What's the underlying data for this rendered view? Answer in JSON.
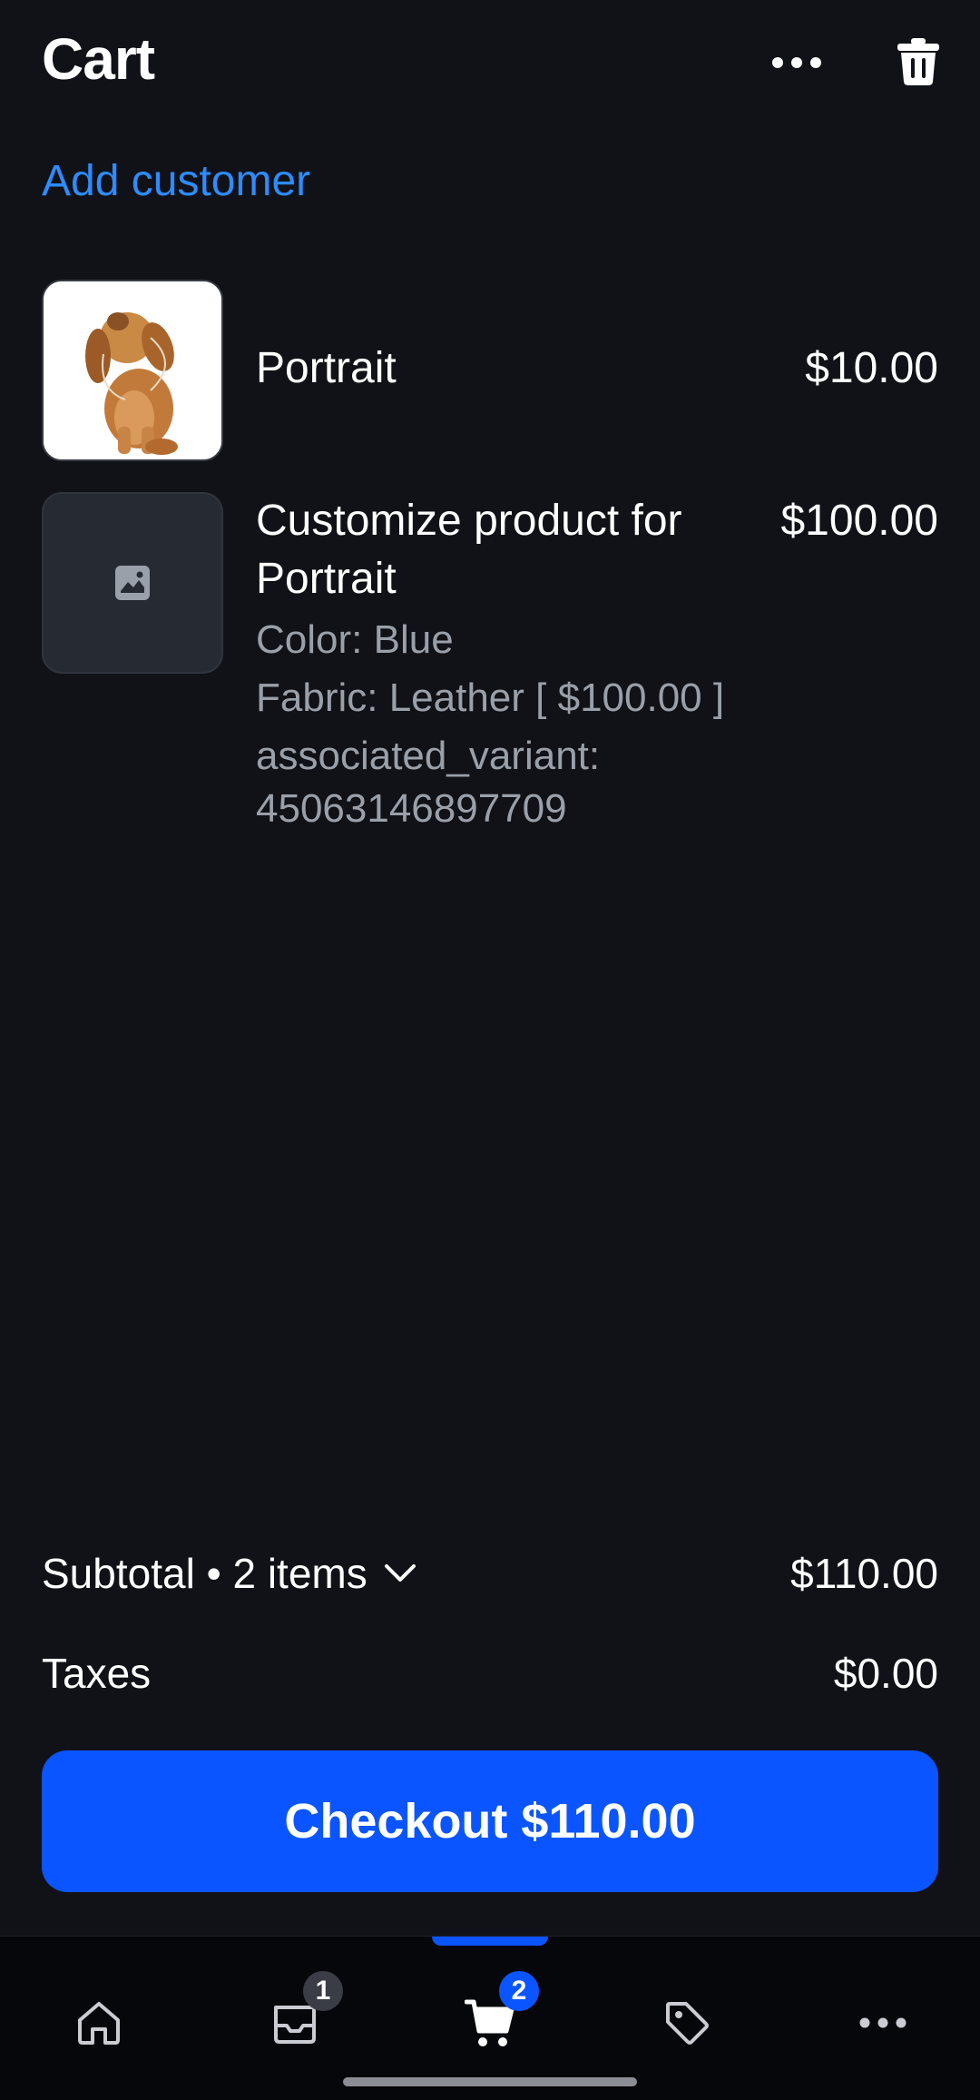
{
  "header": {
    "title": "Cart",
    "more_icon": "ellipsis-horizontal-icon",
    "trash_icon": "trash-icon"
  },
  "add_customer_label": "Add customer",
  "line_items": [
    {
      "name": "Portrait",
      "price": "$10.00",
      "image": "puppy-photo"
    },
    {
      "name_line1": "Customize product for",
      "name_line2": "Portrait",
      "price": "$100.00",
      "image": "image-placeholder-icon",
      "properties": [
        "Color: Blue",
        "Fabric: Leather [ $100.00 ]",
        "associated_variant:",
        "45063146897709"
      ]
    }
  ],
  "summary": {
    "subtotal_label": "Subtotal • 2 items",
    "subtotal_value": "$110.00",
    "taxes_label": "Taxes",
    "taxes_value": "$0.00"
  },
  "checkout_label": "Checkout $110.00",
  "bottom_nav": {
    "items": [
      {
        "icon": "home-icon",
        "badge": ""
      },
      {
        "icon": "inbox-icon",
        "badge": "1"
      },
      {
        "icon": "cart-icon",
        "badge": "2",
        "active": true
      },
      {
        "icon": "tag-icon",
        "badge": ""
      },
      {
        "icon": "more-icon",
        "badge": ""
      }
    ]
  },
  "colors": {
    "background": "#111217",
    "accent": "#0a55ff",
    "link": "#2d8cff",
    "secondary_text": "#9aa0aa"
  }
}
